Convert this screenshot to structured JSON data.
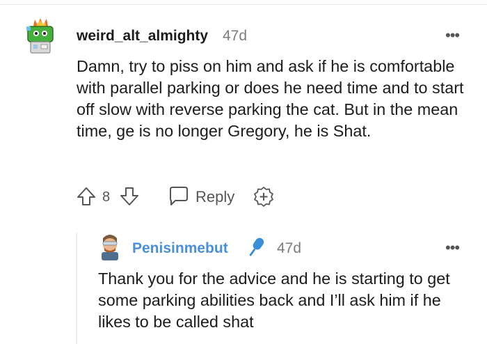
{
  "comment": {
    "username": "weird_alt_almighty",
    "time": "47d",
    "more": "•••",
    "body": "Damn, try to piss on him and ask if he is comfortable with parallel parking or does he need time and to start off slow with reverse parking the cat. But in the mean time, ge is no longer Gregory, he is Shat.",
    "score": "8",
    "reply_label": "Reply",
    "icons": {
      "avatar": "avatar-icon",
      "upvote": "upvote-arrow-icon",
      "downvote": "downvote-arrow-icon",
      "reply": "speech-bubble-icon",
      "award": "add-award-icon"
    }
  },
  "reply": {
    "username": "Penisinmebut",
    "time": "47d",
    "more": "•••",
    "body": "Thank you for the advice and he is starting to get some parking abilities back and I’ll ask him if he likes to be called shat",
    "icons": {
      "avatar": "avatar-icon",
      "badge": "microphone-icon"
    }
  },
  "colors": {
    "reply_username": "#4a8fd9",
    "meta_gray": "#7c7c7c",
    "text": "#1c1c1c"
  }
}
